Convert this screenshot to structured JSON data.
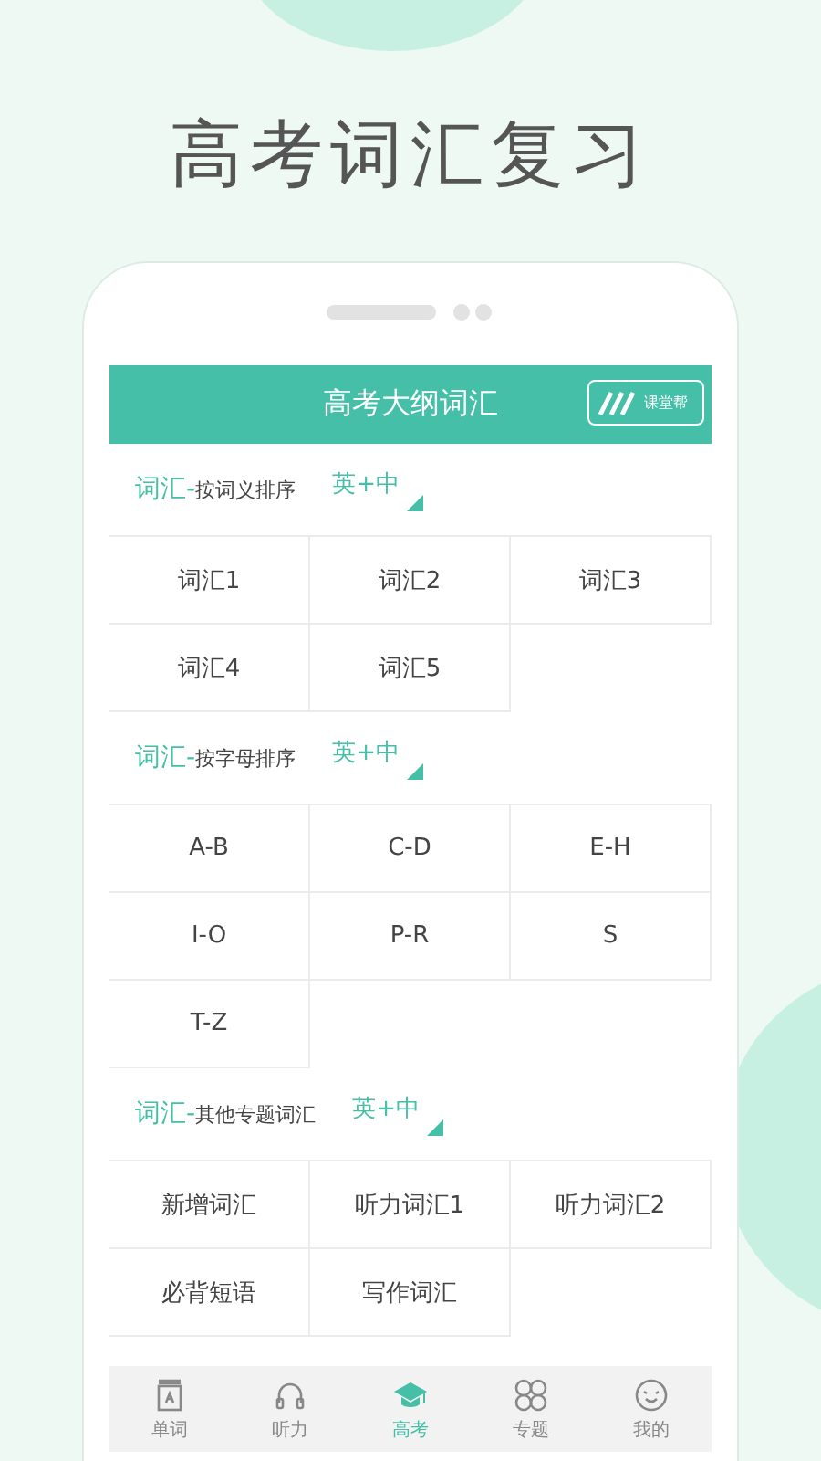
{
  "headline": "高考词汇复习",
  "header": {
    "title": "高考大纲词汇",
    "logo_text": "课堂帮"
  },
  "sections": [
    {
      "prefix": "词汇-",
      "title": "按词义排序",
      "lang": "英+中",
      "items": [
        "词汇1",
        "词汇2",
        "词汇3",
        "词汇4",
        "词汇5"
      ]
    },
    {
      "prefix": "词汇-",
      "title": "按字母排序",
      "lang": "英+中",
      "items": [
        "A-B",
        "C-D",
        "E-H",
        "I-O",
        "P-R",
        "S",
        "T-Z"
      ]
    },
    {
      "prefix": "词汇-",
      "title": "其他专题词汇",
      "lang": "英+中",
      "items": [
        "新增词汇",
        "听力词汇1",
        "听力词汇2",
        "必背短语",
        "写作词汇"
      ]
    }
  ],
  "tabs": [
    {
      "kind": "book",
      "label": "单词",
      "selected": false
    },
    {
      "kind": "headphones",
      "label": "听力",
      "selected": false
    },
    {
      "kind": "cap",
      "label": "高考",
      "selected": true
    },
    {
      "kind": "clover",
      "label": "专题",
      "selected": false
    },
    {
      "kind": "smile",
      "label": "我的",
      "selected": false
    }
  ]
}
